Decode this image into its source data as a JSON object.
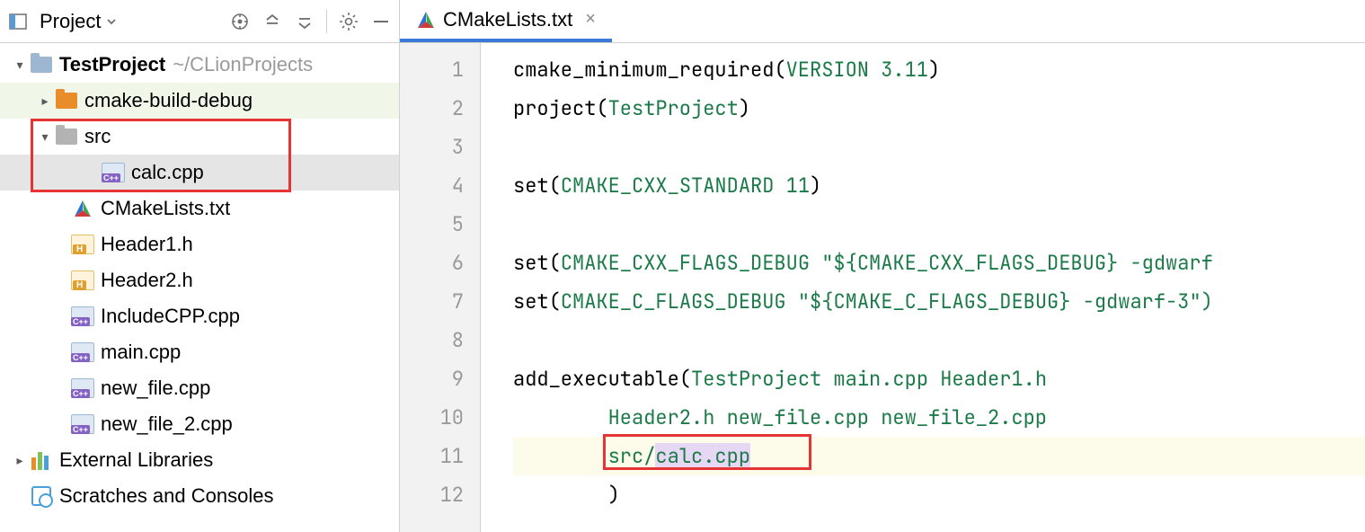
{
  "panel": {
    "title": "Project"
  },
  "tree": {
    "root": {
      "name": "TestProject",
      "path": "~/CLionProjects"
    },
    "build_dir": "cmake-build-debug",
    "src_dir": "src",
    "src_files": [
      "calc.cpp"
    ],
    "files": [
      "CMakeLists.txt",
      "Header1.h",
      "Header2.h",
      "IncludeCPP.cpp",
      "main.cpp",
      "new_file.cpp",
      "new_file_2.cpp"
    ],
    "external": "External Libraries",
    "scratches": "Scratches and Consoles"
  },
  "tab": {
    "name": "CMakeLists.txt"
  },
  "gutter": [
    "1",
    "2",
    "3",
    "4",
    "5",
    "6",
    "7",
    "8",
    "9",
    "10",
    "11",
    "12"
  ],
  "code": {
    "l1": {
      "a": "cmake_minimum_required(",
      "b": "VERSION 3.11",
      "c": ")"
    },
    "l2": {
      "a": "project(",
      "b": "TestProject",
      "c": ")"
    },
    "l4": {
      "a": "set(",
      "b": "CMAKE_CXX_STANDARD 11",
      "c": ")"
    },
    "l6": {
      "a": "set(",
      "b": "CMAKE_CXX_FLAGS_DEBUG ",
      "c": "\"${",
      "d": "CMAKE_CXX_FLAGS_DEBUG",
      "e": "} -gdwarf"
    },
    "l7": {
      "a": "set(",
      "b": "CMAKE_C_FLAGS_DEBUG ",
      "c": "\"${",
      "d": "CMAKE_C_FLAGS_DEBUG",
      "e": "} -gdwarf-3\")"
    },
    "l9": {
      "a": "add_executable(",
      "b": "TestProject main.cpp Header1.h"
    },
    "l10": {
      "a": "Header2.h new_file.cpp new_file_2.cpp"
    },
    "l11": {
      "a": "src/",
      "b": "calc.cpp"
    },
    "l12": ")"
  }
}
